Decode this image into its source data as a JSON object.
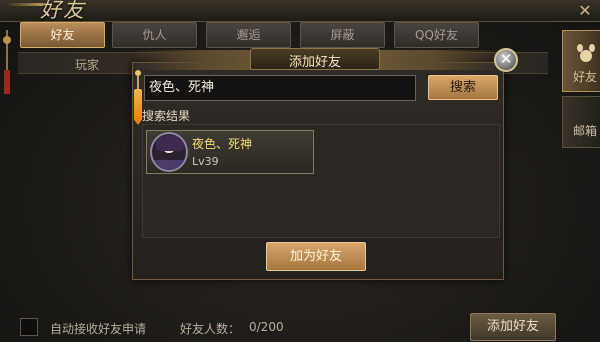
{
  "panel": {
    "title": "好友"
  },
  "tabs": [
    {
      "label": "好友",
      "active": true
    },
    {
      "label": "仇人",
      "active": false
    },
    {
      "label": "邂逅",
      "active": false
    },
    {
      "label": "屏蔽",
      "active": false
    },
    {
      "label": "QQ好友",
      "active": false
    }
  ],
  "list_header": {
    "player_label": "玩家"
  },
  "side_tabs": [
    {
      "label": "好友",
      "icon": "paw-icon",
      "active": true
    },
    {
      "label": "邮箱",
      "active": false
    }
  ],
  "dialog": {
    "title": "添加好友",
    "search_value": "夜色、死神",
    "search_button": "搜索",
    "results_label": "搜索结果",
    "result": {
      "name": "夜色、死神",
      "level": "Lv39"
    },
    "add_button": "加为好友"
  },
  "footer": {
    "auto_accept_label": "自动接收好友申请",
    "friend_count_label": "好友人数：",
    "friend_count_value": "0/200",
    "add_friend_button": "添加好友"
  },
  "colors": {
    "accent_gold": "#d9a868",
    "name_yellow": "#f4dd75",
    "tassel_orange": "#e87914"
  }
}
